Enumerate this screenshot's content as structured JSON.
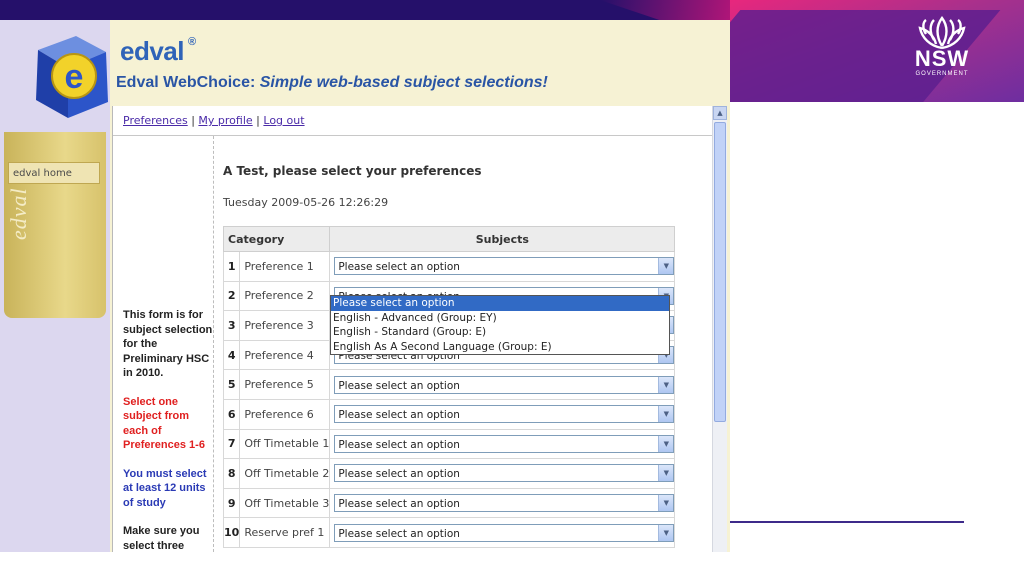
{
  "header": {
    "gov_name": "NSW",
    "gov_sub": "GOVERNMENT"
  },
  "app": {
    "brand": "edval",
    "brand_mark": "®",
    "tagline_bold": "Edval WebChoice:",
    "tagline_italic": "Simple web-based subject selections!",
    "side_home": "edval home",
    "side_brand": "edval"
  },
  "nav": {
    "links": [
      "Preferences",
      "My profile",
      "Log out"
    ],
    "separator": "|"
  },
  "form": {
    "title": "A Test, please select your preferences",
    "date": "Tuesday 2009-05-26 12:26:29",
    "columns": [
      "Category",
      "Subjects"
    ],
    "placeholder": "Please select an option",
    "rows": [
      {
        "num": "1",
        "label": "Preference 1"
      },
      {
        "num": "2",
        "label": "Preference 2"
      },
      {
        "num": "3",
        "label": "Preference 3"
      },
      {
        "num": "4",
        "label": "Preference 4"
      },
      {
        "num": "5",
        "label": "Preference 5"
      },
      {
        "num": "6",
        "label": "Preference 6"
      },
      {
        "num": "7",
        "label": "Off Timetable 1"
      },
      {
        "num": "8",
        "label": "Off Timetable 2"
      },
      {
        "num": "9",
        "label": "Off Timetable 3"
      },
      {
        "num": "10",
        "label": "Reserve pref 1"
      }
    ],
    "dropdown_options": [
      "Please select an option",
      "English - Advanced (Group: EY)",
      "English - Standard (Group: E)",
      "English As A Second Language (Group: E)"
    ]
  },
  "info": {
    "p1": "This form is for subject selection for the Preliminary HSC in 2010.",
    "p2": "Select one subject from each of Preferences 1-6",
    "p3": "You must select at least 12 units of study",
    "p4": "Make sure you select three"
  },
  "colors": {
    "nsw_pink": "#e6287d",
    "nsw_purple": "#25106a",
    "link": "#4a2aa8",
    "alert_red": "#e02020",
    "info_blue": "#2a3ab5"
  }
}
